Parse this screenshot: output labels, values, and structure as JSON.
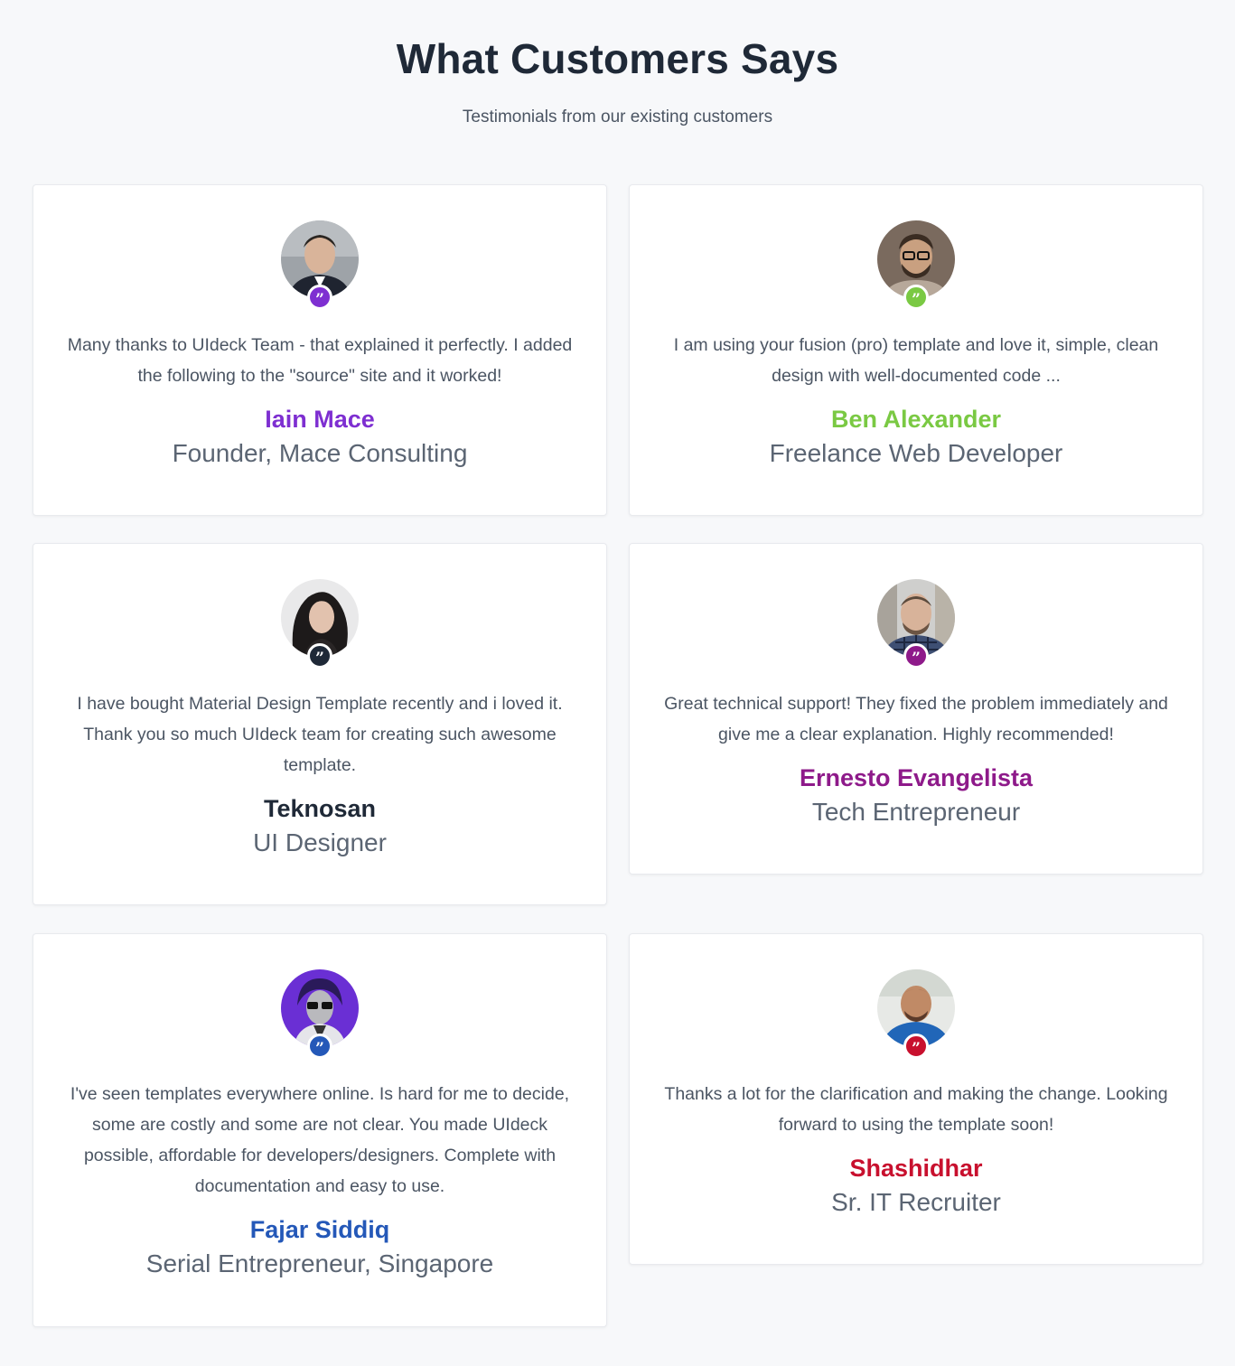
{
  "header": {
    "title": "What Customers Says",
    "subtitle": "Testimonials from our existing customers"
  },
  "testimonials": [
    {
      "quote": "Many thanks to UIdeck Team - that explained it perfectly. I added the following to the \"source\" site and it worked!",
      "name": "Iain Mace",
      "role": "Founder, Mace Consulting",
      "accent": "#7e2fd1",
      "avatar_icon": "person-photo-icon"
    },
    {
      "quote": "I am using your fusion (pro) template and love it, simple, clean design with well-documented code ...",
      "name": "Ben Alexander",
      "role": "Freelance Web Developer",
      "accent": "#7ac943",
      "avatar_icon": "person-photo-icon"
    },
    {
      "quote": "I have bought Material Design Template recently and i loved it. Thank you so much UIdeck team for creating such awesome template.",
      "name": "Teknosan",
      "role": "UI Designer",
      "accent": "#1f2937",
      "avatar_icon": "person-photo-icon"
    },
    {
      "quote": "Great technical support! They fixed the problem immediately and give me a clear explanation. Highly recommended!",
      "name": "Ernesto Evangelista",
      "role": "Tech Entrepreneur",
      "accent": "#8e1a8a",
      "avatar_icon": "person-photo-icon"
    },
    {
      "quote": "I've seen templates everywhere online. Is hard for me to decide, some are costly and some are not clear. You made UIdeck possible, affordable for developers/designers. Complete with documentation and easy to use.",
      "name": "Fajar Siddiq",
      "role": "Serial Entrepreneur, Singapore",
      "accent": "#2458b8",
      "avatar_icon": "person-photo-icon"
    },
    {
      "quote": "Thanks a lot for the clarification and making the change. Looking forward to using the template soon!",
      "name": "Shashidhar",
      "role": "Sr. IT Recruiter",
      "accent": "#c8102e",
      "avatar_icon": "person-photo-icon"
    }
  ],
  "quote_badge_glyph": "”"
}
